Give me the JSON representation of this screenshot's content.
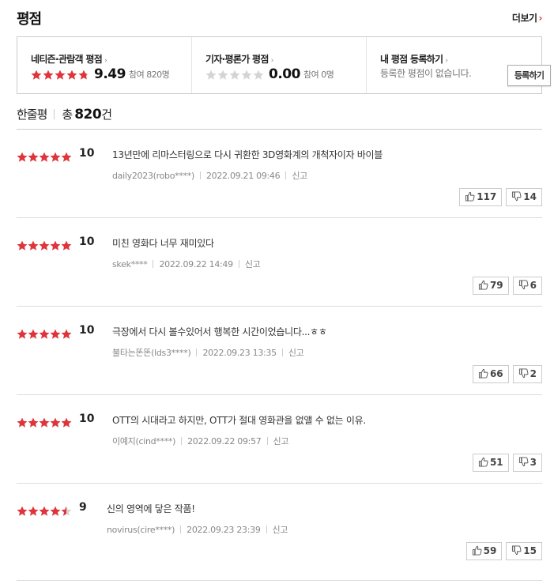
{
  "header": {
    "title": "평점",
    "more_label": "더보기",
    "more_arrow": "›"
  },
  "score_box": {
    "netizen": {
      "label": "네티즌·관람객 평점",
      "score": "9.49",
      "participants": "참여 820명",
      "star_fill": 0.95
    },
    "critic": {
      "label": "기자·평론가 평점",
      "score": "0.00",
      "participants": "참여 0명",
      "star_fill": 0
    },
    "mine": {
      "label": "내 평점 등록하기",
      "subtext": "등록한 평점이 없습니다.",
      "button_label": "등록하기"
    },
    "arrow": "›"
  },
  "section": {
    "title": "한줄평",
    "total_prefix": "총",
    "total_count": "820",
    "total_suffix": "건"
  },
  "reviews": [
    {
      "score": "10",
      "star_fill": 1.0,
      "text": "13년만에 리마스터링으로 다시 귀환한 3D영화계의 개척자이자 바이블",
      "author": "daily2023(robo****)",
      "date": "2022.09.21 09:46",
      "report": "신고",
      "likes": "117",
      "dislikes": "14"
    },
    {
      "score": "10",
      "star_fill": 1.0,
      "text": "미친 영화다 너무 재미있다",
      "author": "skek****",
      "date": "2022.09.22 14:49",
      "report": "신고",
      "likes": "79",
      "dislikes": "6"
    },
    {
      "score": "10",
      "star_fill": 1.0,
      "text": "극장에서 다시 볼수있어서 행복한 시간이었습니다...ㅎㅎ",
      "author": "불타는똔똔(lds3****)",
      "date": "2022.09.23 13:35",
      "report": "신고",
      "likes": "66",
      "dislikes": "2"
    },
    {
      "score": "10",
      "star_fill": 1.0,
      "text": "OTT의 시대라고 하지만, OTT가 절대 영화관을 없앨 수 없는 이유.",
      "author": "이예지(cind****)",
      "date": "2022.09.22 09:57",
      "report": "신고",
      "likes": "51",
      "dislikes": "3"
    },
    {
      "score": "9",
      "star_fill": 0.9,
      "text": "신의 영역에 닿은 작품!",
      "author": "novirus(cire****)",
      "date": "2022.09.23 23:39",
      "report": "신고",
      "likes": "59",
      "dislikes": "15"
    }
  ],
  "colors": {
    "star_on": "#e0343a",
    "star_off": "#d4d4d4",
    "accent": "#e0343a"
  },
  "icons": {
    "like": "thumbs-up-icon",
    "dislike": "thumbs-down-icon",
    "star": "star-icon"
  }
}
